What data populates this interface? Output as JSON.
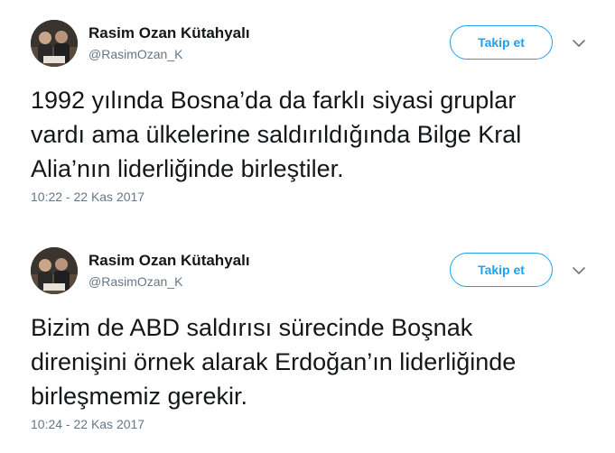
{
  "tweets": [
    {
      "name": "Rasim Ozan Kütahyalı",
      "handle": "@RasimOzan_K",
      "follow_label": "Takip et",
      "text_lines": [
        "1992 yılında Bosna’da da farklı siyasi gruplar",
        "vardı ama ülkelerine saldırıldığında Bilge Kral",
        "Alia’nın liderliğinde birleştiler."
      ],
      "timestamp": "10:22 - 22 Kas 2017",
      "menu_icon": "chevron-down-icon"
    },
    {
      "name": "Rasim Ozan Kütahyalı",
      "handle": "@RasimOzan_K",
      "follow_label": "Takip et",
      "text_lines": [
        "Bizim de ABD saldırısı sürecinde Boşnak",
        "direnişini örnek alarak Erdoğan’ın liderliğinde",
        "birleşmemiz gerekir."
      ],
      "timestamp": "10:24 - 22 Kas 2017",
      "menu_icon": "chevron-down-icon"
    }
  ],
  "colors": {
    "accent": "#1da1f2",
    "text": "#14171a",
    "muted": "#657786"
  }
}
